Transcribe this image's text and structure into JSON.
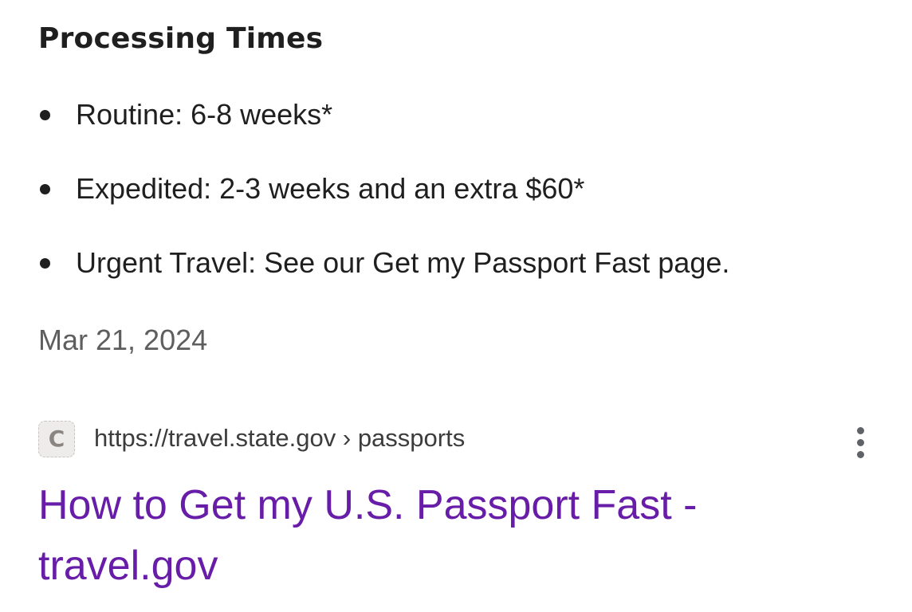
{
  "snippet": {
    "heading": "Processing Times",
    "items": [
      "Routine: 6-8 weeks*",
      "Expedited: 2-3 weeks and an extra $60*",
      "Urgent Travel: See our Get my Passport Fast page."
    ],
    "date": "Mar 21, 2024"
  },
  "result": {
    "favicon": "C",
    "url": "https://travel.state.gov › passports",
    "title": "How to Get my U.S. Passport Fast - travel.gov",
    "more_icon": "more-vert-icon"
  },
  "colors": {
    "link_visited": "#681da8",
    "text_primary": "#1f1f1f",
    "text_secondary": "#5e5e5e"
  }
}
